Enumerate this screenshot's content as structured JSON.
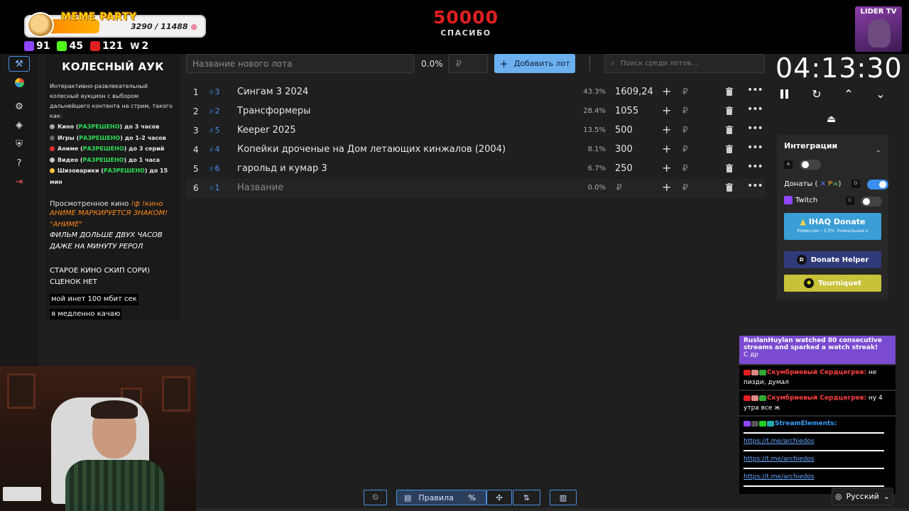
{
  "overlay": {
    "meme_party": {
      "title": "MEME PARTY",
      "progress": "3290 / 11488"
    },
    "stats": [
      {
        "icon": "twitch-subs-icon",
        "value": "91",
        "color": "#9146ff"
      },
      {
        "icon": "kick-icon",
        "value": "45",
        "color": "#53fc18"
      },
      {
        "icon": "live-icon",
        "value": "121",
        "color": "#e02020"
      },
      {
        "icon": "w-icon",
        "value": "2",
        "color": "#ffffff"
      }
    ],
    "goal": {
      "value": "50000",
      "label": "СПАСИБО"
    },
    "channel_logo": "LIDER TV"
  },
  "description": {
    "title": "КОЛЕСНЫЙ АУК",
    "intro": "Интерактивно-развлекательный колесный аукцион с выбором дальнейшего контента на стрим, такого как:",
    "items": [
      {
        "name": "Кино",
        "status": "РАЗРЕШЕНО",
        "limit": "до 3 часов"
      },
      {
        "name": "Игры",
        "status": "РАЗРЕШЕНО",
        "limit": "до 1-2 часов"
      },
      {
        "name": "Аниме",
        "status": "РАЗРЕШЕНО",
        "limit": "до 3 серий"
      },
      {
        "name": "Видео",
        "status": "РАЗРЕШЕНО",
        "limit": "до 1 часа"
      },
      {
        "name": "Шизоварики",
        "status": "РАЗРЕШЕНО",
        "limit": "до 15 мин"
      }
    ],
    "watched": "Просмотренное кино",
    "watched_cmd": "!ф !кино",
    "anime_line1": "АНИМЕ МАРКИРУЕТСЯ ЗНАКОМ!",
    "anime_line2": "\"АНИМЕ\"",
    "film_line1": "ФИЛЬМ ДОЛЬШЕ ДВУХ ЧАСОВ",
    "film_line2": "ДАЖЕ НА МИНУТУ РЕРОЛ",
    "old_line1": "СТАРОЕ КИНО СКИП СОРИ)",
    "old_line2": "СЦЕНОК НЕТ",
    "net_line1": "мой инет 100 мбит сек",
    "net_line2": "я медленно качаю"
  },
  "lot_form": {
    "name_placeholder": "Название нового лота",
    "percent": "0.0%",
    "amount_placeholder": "₽",
    "add_label": "Добавить лот",
    "search_placeholder": "Поиск среди лотов..."
  },
  "lots": [
    {
      "n": "1",
      "id": "3",
      "name": "Сингам 3 2024",
      "percent": "43.3%",
      "amount": "1609,24"
    },
    {
      "n": "2",
      "id": "2",
      "name": "Трансформеры",
      "percent": "28.4%",
      "amount": "1055"
    },
    {
      "n": "3",
      "id": "5",
      "name": "Keeper 2025",
      "percent": "13.5%",
      "amount": "500"
    },
    {
      "n": "4",
      "id": "4",
      "name": "Копейки дроченые на Дом летающих кинжалов (2004)",
      "percent": "8.1%",
      "amount": "300"
    },
    {
      "n": "5",
      "id": "6",
      "name": "гарольд и кумар 3",
      "percent": "6.7%",
      "amount": "250"
    },
    {
      "n": "6",
      "id": "1",
      "name": "Название",
      "percent": "0.0%",
      "amount": "₽"
    }
  ],
  "currency": "₽",
  "timer": {
    "value": "04:13:30"
  },
  "integrations": {
    "title": "Интеграции",
    "auto_key": "A",
    "donations_label": "Донаты (",
    "donations_key": "D",
    "twitch_label": "Twitch",
    "twitch_key": "C",
    "ihaq": {
      "label": "IHAQ Donate",
      "note": "Комиссия – 3,5%. Уникальные к"
    },
    "donate_helper": "Donate Helper",
    "tourniquet": "Tourniquet"
  },
  "chat": {
    "watch_msg": "RuslanHuylan watched 80 consecutive streams and sparked a watch streak!",
    "watch_sub": "С др",
    "messages": [
      {
        "user": "Скумбриевый Сердцегрев:",
        "text": "не пизди, думал"
      },
      {
        "user": "Скумбриевый Сердцегрев:",
        "text": "ну 4 утра все ж"
      }
    ],
    "bot_user": "StreamElements:",
    "links": [
      "https://t.me/archiedos",
      "https://t.me/archiedos",
      "https://t.me/archiedos"
    ]
  },
  "toolbar": {
    "rules_label": "Правила",
    "language": "Русский"
  }
}
